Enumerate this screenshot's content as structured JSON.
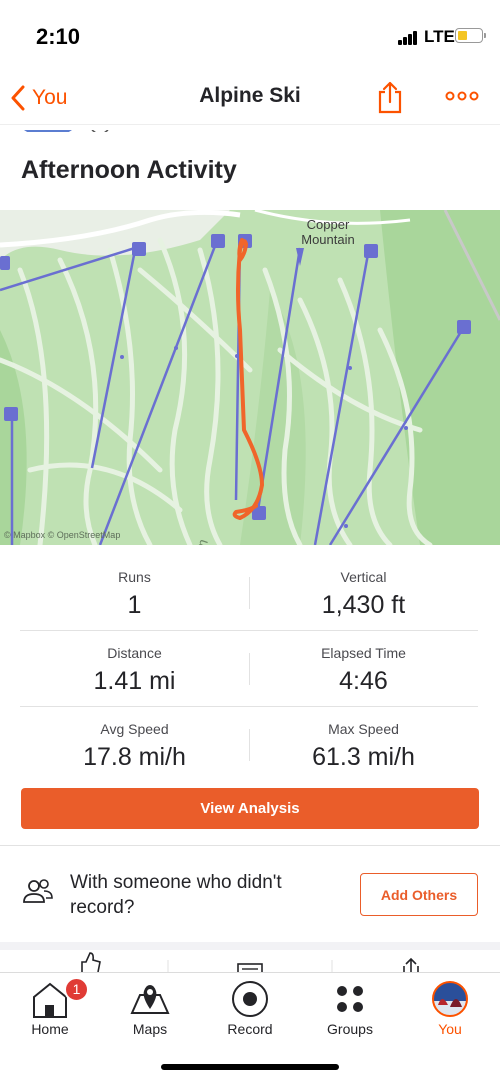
{
  "status_bar": {
    "time": "2:10",
    "network": "LTE"
  },
  "nav": {
    "back_label": "You",
    "title": "Alpine Ski"
  },
  "activity": {
    "title": "Afternoon Activity"
  },
  "map": {
    "place_label": "Copper Mountain",
    "attribution": "© Mapbox © OpenStreetMap"
  },
  "stats": [
    {
      "label": "Runs",
      "value": "1"
    },
    {
      "label": "Vertical",
      "value": "1,430 ft"
    },
    {
      "label": "Distance",
      "value": "1.41 mi"
    },
    {
      "label": "Elapsed Time",
      "value": "4:46"
    },
    {
      "label": "Avg Speed",
      "value": "17.8 mi/h"
    },
    {
      "label": "Max Speed",
      "value": "61.3 mi/h"
    }
  ],
  "analysis_button": "View Analysis",
  "record_prompt": {
    "text": "With someone who didn't record?",
    "button": "Add Others"
  },
  "tabs": [
    {
      "label": "Home",
      "icon": "home-icon",
      "badge": "1"
    },
    {
      "label": "Maps",
      "icon": "map-icon"
    },
    {
      "label": "Record",
      "icon": "record-icon"
    },
    {
      "label": "Groups",
      "icon": "groups-icon"
    },
    {
      "label": "You",
      "icon": "avatar",
      "active": true
    }
  ],
  "colors": {
    "accent": "#fc5200",
    "button": "#ea5d2a",
    "route": "#f0652a",
    "lift": "#6a6fd1",
    "badge": "#e03b35"
  }
}
